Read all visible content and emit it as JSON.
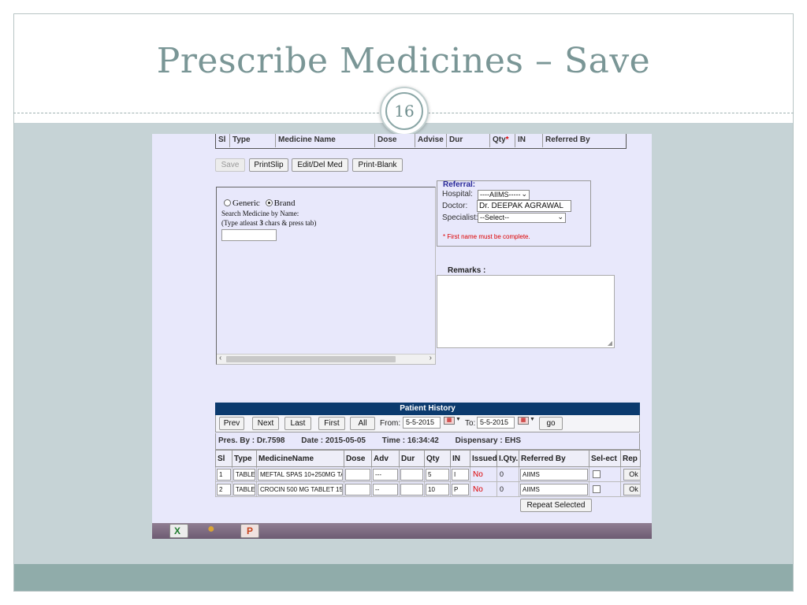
{
  "slide": {
    "title": "Prescribe Medicines – Save",
    "page_number": "16",
    "colors": {
      "title": "#7a9696",
      "band": "#c6d3d6",
      "footer": "#90acaa",
      "panel_bg": "#e8e8fb",
      "history_header": "#0b3a6e"
    }
  },
  "form": {
    "top_header_columns": [
      "Sl",
      "Type",
      "Medicine Name",
      "Dose",
      "Advise",
      "Dur",
      "Qty",
      "IN",
      "Referred By"
    ],
    "qty_required_marker": "*",
    "buttons": {
      "save": "Save",
      "print_slip": "PrintSlip",
      "edit_del_med": "Edit/Del Med",
      "print_blank": "Print-Blank"
    },
    "search": {
      "generic_label": "Generic",
      "brand_label": "Brand",
      "selected": "Brand",
      "by_name_label": "Search Medicine by Name:",
      "hint_prefix": "(Type atleast ",
      "hint_number": "3",
      "hint_suffix": " chars & press tab)",
      "input_value": ""
    },
    "referral": {
      "legend": "Referral:",
      "hospital_label": "Hospital:",
      "hospital_value": "----AIIMS-----",
      "doctor_label": "Doctor:",
      "doctor_value": "Dr. DEEPAK AGRAWAL",
      "specialist_label": "Specialist:",
      "specialist_value": "--Select--",
      "error": "* First name must be complete."
    },
    "remarks": {
      "label": "Remarks :",
      "value": ""
    }
  },
  "history": {
    "title": "Patient History",
    "nav": {
      "prev": "Prev",
      "next": "Next",
      "last": "Last",
      "first": "First",
      "all": "All"
    },
    "from_label": "From:",
    "from_value": "5-5-2015",
    "to_label": "To:",
    "to_value": "5-5-2015",
    "go": "go",
    "pres_by": "Pres. By : Dr.7598",
    "date": "Date : 2015-05-05",
    "time": "Time : 16:34:42",
    "dispensary": "Dispensary : EHS",
    "columns": [
      "Sl",
      "Type",
      "MedicineName",
      "Dose",
      "Adv",
      "Dur",
      "Qty",
      "IN",
      "Issued",
      "I.Qty.",
      "Referred By",
      "Sel-ect",
      "Rep"
    ],
    "rows": [
      {
        "sl": "1",
        "type": "TABLE",
        "medicine": "MEFTAL SPAS 10+250MG TA",
        "dose": "",
        "adv": "---",
        "dur": "",
        "qty": "5",
        "in": "I",
        "issued": "No",
        "iqty": "0",
        "referred_by": "AIIMS",
        "rep": "Ok"
      },
      {
        "sl": "2",
        "type": "TABLE",
        "medicine": "CROCIN 500 MG TABLET 15",
        "dose": "",
        "adv": "--",
        "dur": "",
        "qty": "10",
        "in": "P",
        "issued": "No",
        "iqty": "0",
        "referred_by": "AIIMS",
        "rep": "Ok"
      }
    ],
    "repeat_selected": "Repeat Selected"
  },
  "taskbar": {
    "icons": [
      "excel-icon",
      "paint-icon",
      "powerpoint-icon"
    ]
  }
}
